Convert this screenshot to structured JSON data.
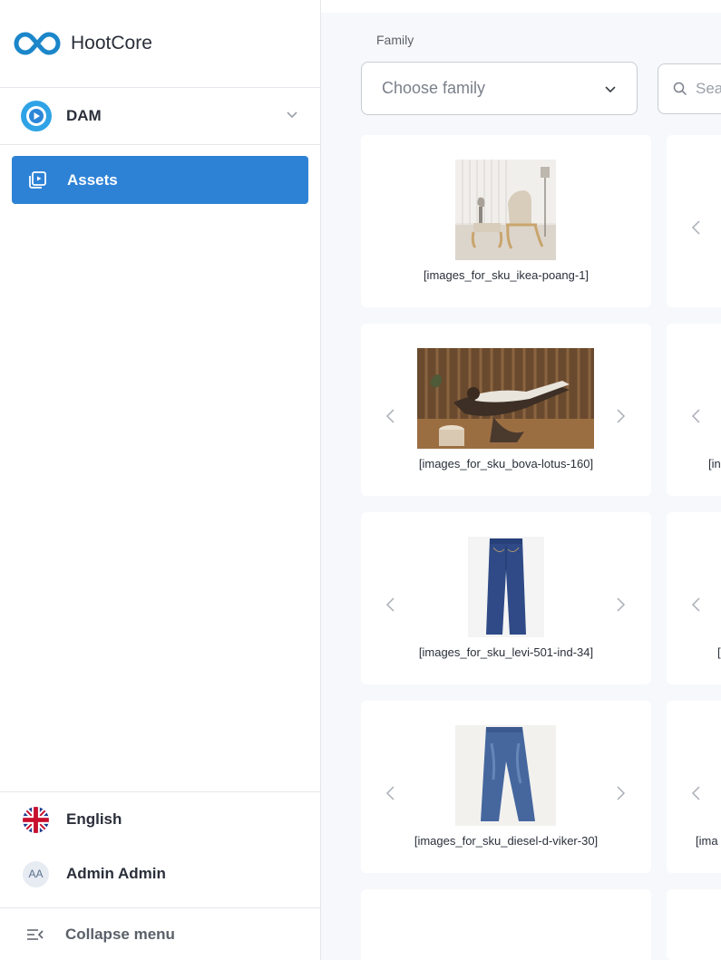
{
  "app": {
    "brand_name": "HootCore"
  },
  "sidebar": {
    "module": {
      "label": "DAM"
    },
    "nav": [
      {
        "label": "Assets",
        "active": true
      }
    ],
    "language": {
      "label": "English"
    },
    "user": {
      "initials": "AA",
      "name": "Admin Admin"
    },
    "collapse_label": "Collapse menu"
  },
  "filters": {
    "family_label": "Family",
    "family_placeholder": "Choose family",
    "search_placeholder": "Search"
  },
  "assets": [
    {
      "caption": "[images_for_sku_ikea-poang-1]",
      "has_arrows": false
    },
    {
      "caption": "[images_for_sku_bova-lotus-160]",
      "has_arrows": true
    },
    {
      "caption": "[images_for_sku_levi-501-ind-34]",
      "has_arrows": true
    },
    {
      "caption": "[images_for_sku_diesel-d-viker-30]",
      "has_arrows": true
    }
  ],
  "assets_right": [
    {
      "caption": ""
    },
    {
      "caption": "[in"
    },
    {
      "caption": "["
    },
    {
      "caption": "[ima"
    }
  ],
  "colors": {
    "accent": "#2d82d6",
    "logo": "#1b86c9",
    "text": "#2a2f3a"
  }
}
